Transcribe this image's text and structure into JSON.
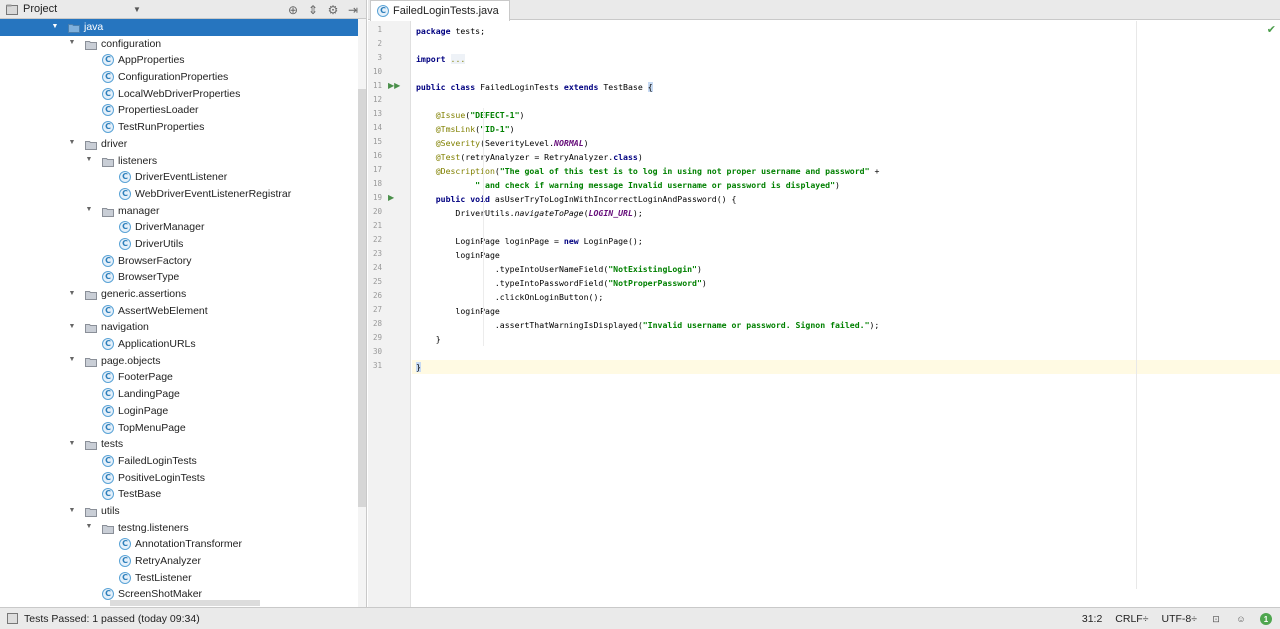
{
  "project_panel": {
    "title": "Project"
  },
  "tree": [
    {
      "label": "java",
      "type": "folder",
      "depth": 0,
      "expanded": true,
      "selected": true
    },
    {
      "label": "configuration",
      "type": "package",
      "depth": 1,
      "expanded": true
    },
    {
      "label": "AppProperties",
      "type": "class",
      "depth": 2
    },
    {
      "label": "ConfigurationProperties",
      "type": "class",
      "depth": 2
    },
    {
      "label": "LocalWebDriverProperties",
      "type": "class",
      "depth": 2
    },
    {
      "label": "PropertiesLoader",
      "type": "class",
      "depth": 2
    },
    {
      "label": "TestRunProperties",
      "type": "class",
      "depth": 2
    },
    {
      "label": "driver",
      "type": "package",
      "depth": 1,
      "expanded": true
    },
    {
      "label": "listeners",
      "type": "package",
      "depth": 2,
      "expanded": true
    },
    {
      "label": "DriverEventListener",
      "type": "class",
      "depth": 3
    },
    {
      "label": "WebDriverEventListenerRegistrar",
      "type": "class",
      "depth": 3
    },
    {
      "label": "manager",
      "type": "package",
      "depth": 2,
      "expanded": true
    },
    {
      "label": "DriverManager",
      "type": "class",
      "depth": 3
    },
    {
      "label": "DriverUtils",
      "type": "class",
      "depth": 3
    },
    {
      "label": "BrowserFactory",
      "type": "class",
      "depth": 2
    },
    {
      "label": "BrowserType",
      "type": "class",
      "depth": 2
    },
    {
      "label": "generic.assertions",
      "type": "package",
      "depth": 1,
      "expanded": true
    },
    {
      "label": "AssertWebElement",
      "type": "class",
      "depth": 2
    },
    {
      "label": "navigation",
      "type": "package",
      "depth": 1,
      "expanded": true
    },
    {
      "label": "ApplicationURLs",
      "type": "class",
      "depth": 2
    },
    {
      "label": "page.objects",
      "type": "package",
      "depth": 1,
      "expanded": true
    },
    {
      "label": "FooterPage",
      "type": "class",
      "depth": 2
    },
    {
      "label": "LandingPage",
      "type": "class",
      "depth": 2
    },
    {
      "label": "LoginPage",
      "type": "class",
      "depth": 2
    },
    {
      "label": "TopMenuPage",
      "type": "class",
      "depth": 2
    },
    {
      "label": "tests",
      "type": "package",
      "depth": 1,
      "expanded": true
    },
    {
      "label": "FailedLoginTests",
      "type": "class",
      "depth": 2
    },
    {
      "label": "PositiveLoginTests",
      "type": "class",
      "depth": 2
    },
    {
      "label": "TestBase",
      "type": "class",
      "depth": 2
    },
    {
      "label": "utils",
      "type": "package",
      "depth": 1,
      "expanded": true
    },
    {
      "label": "testng.listeners",
      "type": "package",
      "depth": 2,
      "expanded": true
    },
    {
      "label": "AnnotationTransformer",
      "type": "class",
      "depth": 3
    },
    {
      "label": "RetryAnalyzer",
      "type": "class",
      "depth": 3
    },
    {
      "label": "TestListener",
      "type": "class",
      "depth": 3
    },
    {
      "label": "ScreenShotMaker",
      "type": "class",
      "depth": 2
    }
  ],
  "editor": {
    "tab_label": "FailedLoginTests.java",
    "current_line": 31,
    "lines": [
      {
        "n": "1",
        "html": "<span class=\"kw\">package</span> tests;"
      },
      {
        "n": "2",
        "html": ""
      },
      {
        "n": "3",
        "html": "<span class=\"kw\">import</span> <span class=\"fold-txt\">...</span>"
      },
      {
        "n": "10",
        "html": ""
      },
      {
        "n": "11",
        "html": "<span class=\"kw\">public class</span> FailedLoginTests <span class=\"kw\">extends</span> TestBase <span class=\"brace\">{</span>",
        "run": true
      },
      {
        "n": "12",
        "html": ""
      },
      {
        "n": "13",
        "html": "    <span class=\"ann\">@Issue</span>(<span class=\"str\">\"DEFECT-1\"</span>)"
      },
      {
        "n": "14",
        "html": "    <span class=\"ann\">@TmsLink</span>(<span class=\"str\">\"ID-1\"</span>)"
      },
      {
        "n": "15",
        "html": "    <span class=\"ann\">@Severity</span>(SeverityLevel.<span class=\"st\">NORMAL</span>)"
      },
      {
        "n": "16",
        "html": "    <span class=\"ann\">@Test</span>(retryAnalyzer = RetryAnalyzer.<span class=\"kw\">class</span>)"
      },
      {
        "n": "17",
        "html": "    <span class=\"ann\">@Description</span>(<span class=\"str\">\"The goal of this test is to log in using not proper username and password\"</span> +"
      },
      {
        "n": "18",
        "html": "            <span class=\"str\">\" and check if warning message Invalid username or password is displayed\"</span>)"
      },
      {
        "n": "19",
        "html": "    <span class=\"kw\">public void</span> asUserTryToLogInWithIncorrectLoginAndPassword() {",
        "run": true
      },
      {
        "n": "20",
        "html": "        DriverUtils.<span class=\"it\">navigateToPage</span>(<span class=\"st\">LOGIN_URL</span>);"
      },
      {
        "n": "21",
        "html": ""
      },
      {
        "n": "22",
        "html": "        LoginPage loginPage = <span class=\"kw\">new</span> LoginPage();"
      },
      {
        "n": "23",
        "html": "        loginPage"
      },
      {
        "n": "24",
        "html": "                .typeIntoUserNameField(<span class=\"str\">\"NotExistingLogin\"</span>)"
      },
      {
        "n": "25",
        "html": "                .typeIntoPasswordField(<span class=\"str\">\"NotProperPassword\"</span>)"
      },
      {
        "n": "26",
        "html": "                .clickOnLoginButton();"
      },
      {
        "n": "27",
        "html": "        loginPage"
      },
      {
        "n": "28",
        "html": "                .assertThatWarningIsDisplayed(<span class=\"str\">\"Invalid username or password. Signon failed.\"</span>);"
      },
      {
        "n": "29",
        "html": "    }"
      },
      {
        "n": "30",
        "html": ""
      },
      {
        "n": "31",
        "html": "<span class=\"brace\">}</span>"
      }
    ]
  },
  "status_bar": {
    "message": "Tests Passed: 1 passed (today 09:34)",
    "position": "31:2",
    "line_separator": "CRLF÷",
    "encoding": "UTF-8÷",
    "events_count": "1"
  }
}
